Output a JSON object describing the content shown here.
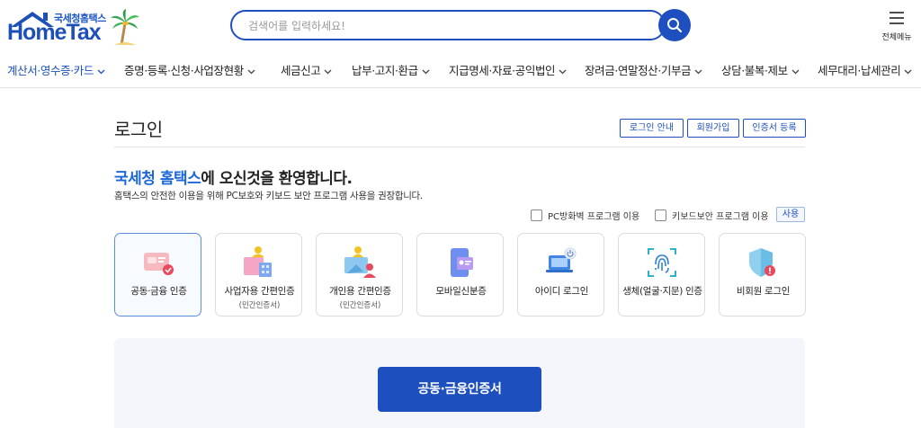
{
  "header": {
    "logo_small": "국세청홈택스",
    "logo_main": "HomeTax",
    "search_placeholder": "검색어를 입력하세요!",
    "all_menu_label": "전체메뉴"
  },
  "nav": {
    "items": [
      {
        "label": "계산서·영수증·카드"
      },
      {
        "label": "증명·등록·신청·사업장현황"
      },
      {
        "label": "세금신고"
      },
      {
        "label": "납부·고지·환급"
      },
      {
        "label": "지급명세·자료·공익법인"
      },
      {
        "label": "장려금·연말정산·기부금"
      },
      {
        "label": "상담·불복·제보"
      },
      {
        "label": "세무대리·납세관리"
      }
    ]
  },
  "page": {
    "title": "로그인",
    "buttons": {
      "login_guide": "로그인 안내",
      "signup": "회원가입",
      "cert_register": "인증서 등록"
    },
    "welcome_highlight": "국세청 홈택스",
    "welcome_rest": "에 오신것을 환영합니다.",
    "description": "홈택스의 안전한 이용을 위해 PC보호와 키보드 보안 프로그램 사용을 권장합니다.",
    "options": {
      "pc_firewall": "PC방화벽 프로그램 이용",
      "keyboard_security": "키보드보안 프로그램 이용",
      "use_button": "사용"
    },
    "login_methods": [
      {
        "label": "공동·금융 인증",
        "sub": ""
      },
      {
        "label": "사업자용 간편인증",
        "sub": "(민간인증서)"
      },
      {
        "label": "개인용 간편인증",
        "sub": "(민간인증서)"
      },
      {
        "label": "모바일신분증",
        "sub": ""
      },
      {
        "label": "아이디 로그인",
        "sub": ""
      },
      {
        "label": "생체(얼굴·지문) 인증",
        "sub": ""
      },
      {
        "label": "비회원 로그인",
        "sub": ""
      }
    ],
    "main_button": "공동·금융인증서"
  },
  "colors": {
    "primary": "#1d4fbf",
    "highlight": "#1d68d9",
    "panel_bg": "#f4f6fa"
  }
}
